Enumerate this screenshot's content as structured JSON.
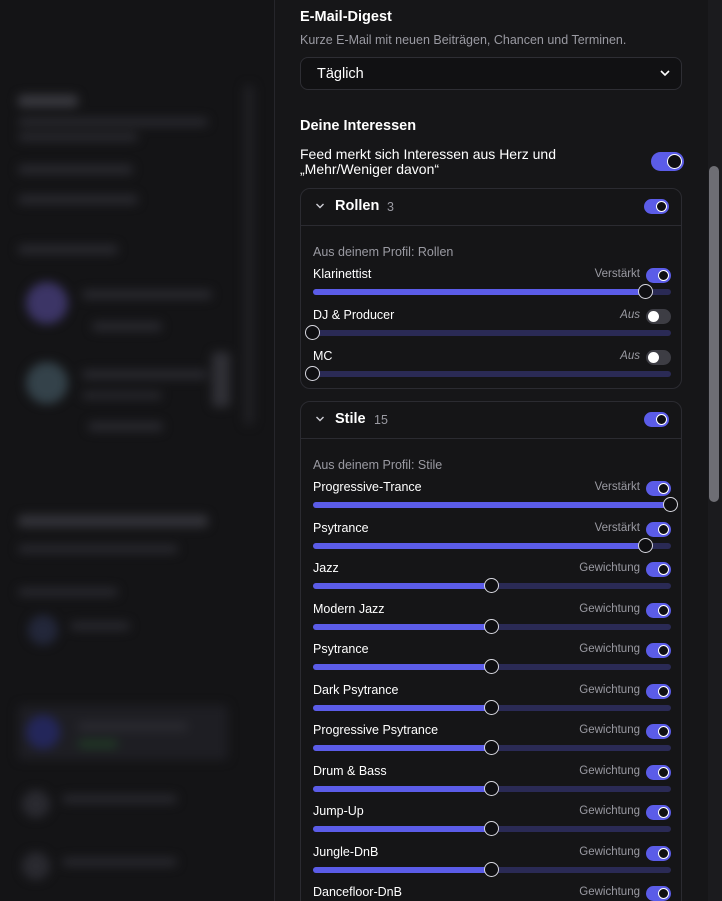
{
  "digest": {
    "title": "E-Mail-Digest",
    "description": "Kurze E-Mail mit neuen Beiträgen, Chancen und Terminen.",
    "selected": "Täglich"
  },
  "interests": {
    "title": "Deine Interessen",
    "feed_toggle_label_line1": "Feed merkt sich Interessen aus Herz und",
    "feed_toggle_label_line2": "„Mehr/Weniger davon“",
    "feed_toggle_on": true
  },
  "groups": [
    {
      "title": "Rollen",
      "count": "3",
      "enabled": true,
      "source_label": "Aus deinem Profil: Rollen",
      "items": [
        {
          "label": "Klarinettist",
          "status": "Verstärkt",
          "on": true,
          "level": 0.93
        },
        {
          "label": "DJ & Producer",
          "status": "Aus",
          "on": false,
          "level": 0.0
        },
        {
          "label": "MC",
          "status": "Aus",
          "on": false,
          "level": 0.0
        }
      ]
    },
    {
      "title": "Stile",
      "count": "15",
      "enabled": true,
      "source_label": "Aus deinem Profil: Stile",
      "items": [
        {
          "label": "Progressive-Trance",
          "status": "Verstärkt",
          "on": true,
          "level": 1.0
        },
        {
          "label": "Psytrance",
          "status": "Verstärkt",
          "on": true,
          "level": 0.93
        },
        {
          "label": "Jazz",
          "status": "Gewichtung",
          "on": true,
          "level": 0.5
        },
        {
          "label": "Modern Jazz",
          "status": "Gewichtung",
          "on": true,
          "level": 0.5
        },
        {
          "label": "Psytrance",
          "status": "Gewichtung",
          "on": true,
          "level": 0.5
        },
        {
          "label": "Dark Psytrance",
          "status": "Gewichtung",
          "on": true,
          "level": 0.5
        },
        {
          "label": "Progressive Psytrance",
          "status": "Gewichtung",
          "on": true,
          "level": 0.5
        },
        {
          "label": "Drum & Bass",
          "status": "Gewichtung",
          "on": true,
          "level": 0.5
        },
        {
          "label": "Jump-Up",
          "status": "Gewichtung",
          "on": true,
          "level": 0.5
        },
        {
          "label": "Jungle-DnB",
          "status": "Gewichtung",
          "on": true,
          "level": 0.5
        },
        {
          "label": "Dancefloor-DnB",
          "status": "Gewichtung",
          "on": true,
          "level": 0.5
        }
      ]
    }
  ],
  "colors": {
    "accent": "#5b5ce8",
    "track": "#2a2a55",
    "panel": "#161618"
  },
  "icons": {
    "select_arrow": "chevron-down-icon",
    "group_collapse": "chevron-down-icon"
  }
}
